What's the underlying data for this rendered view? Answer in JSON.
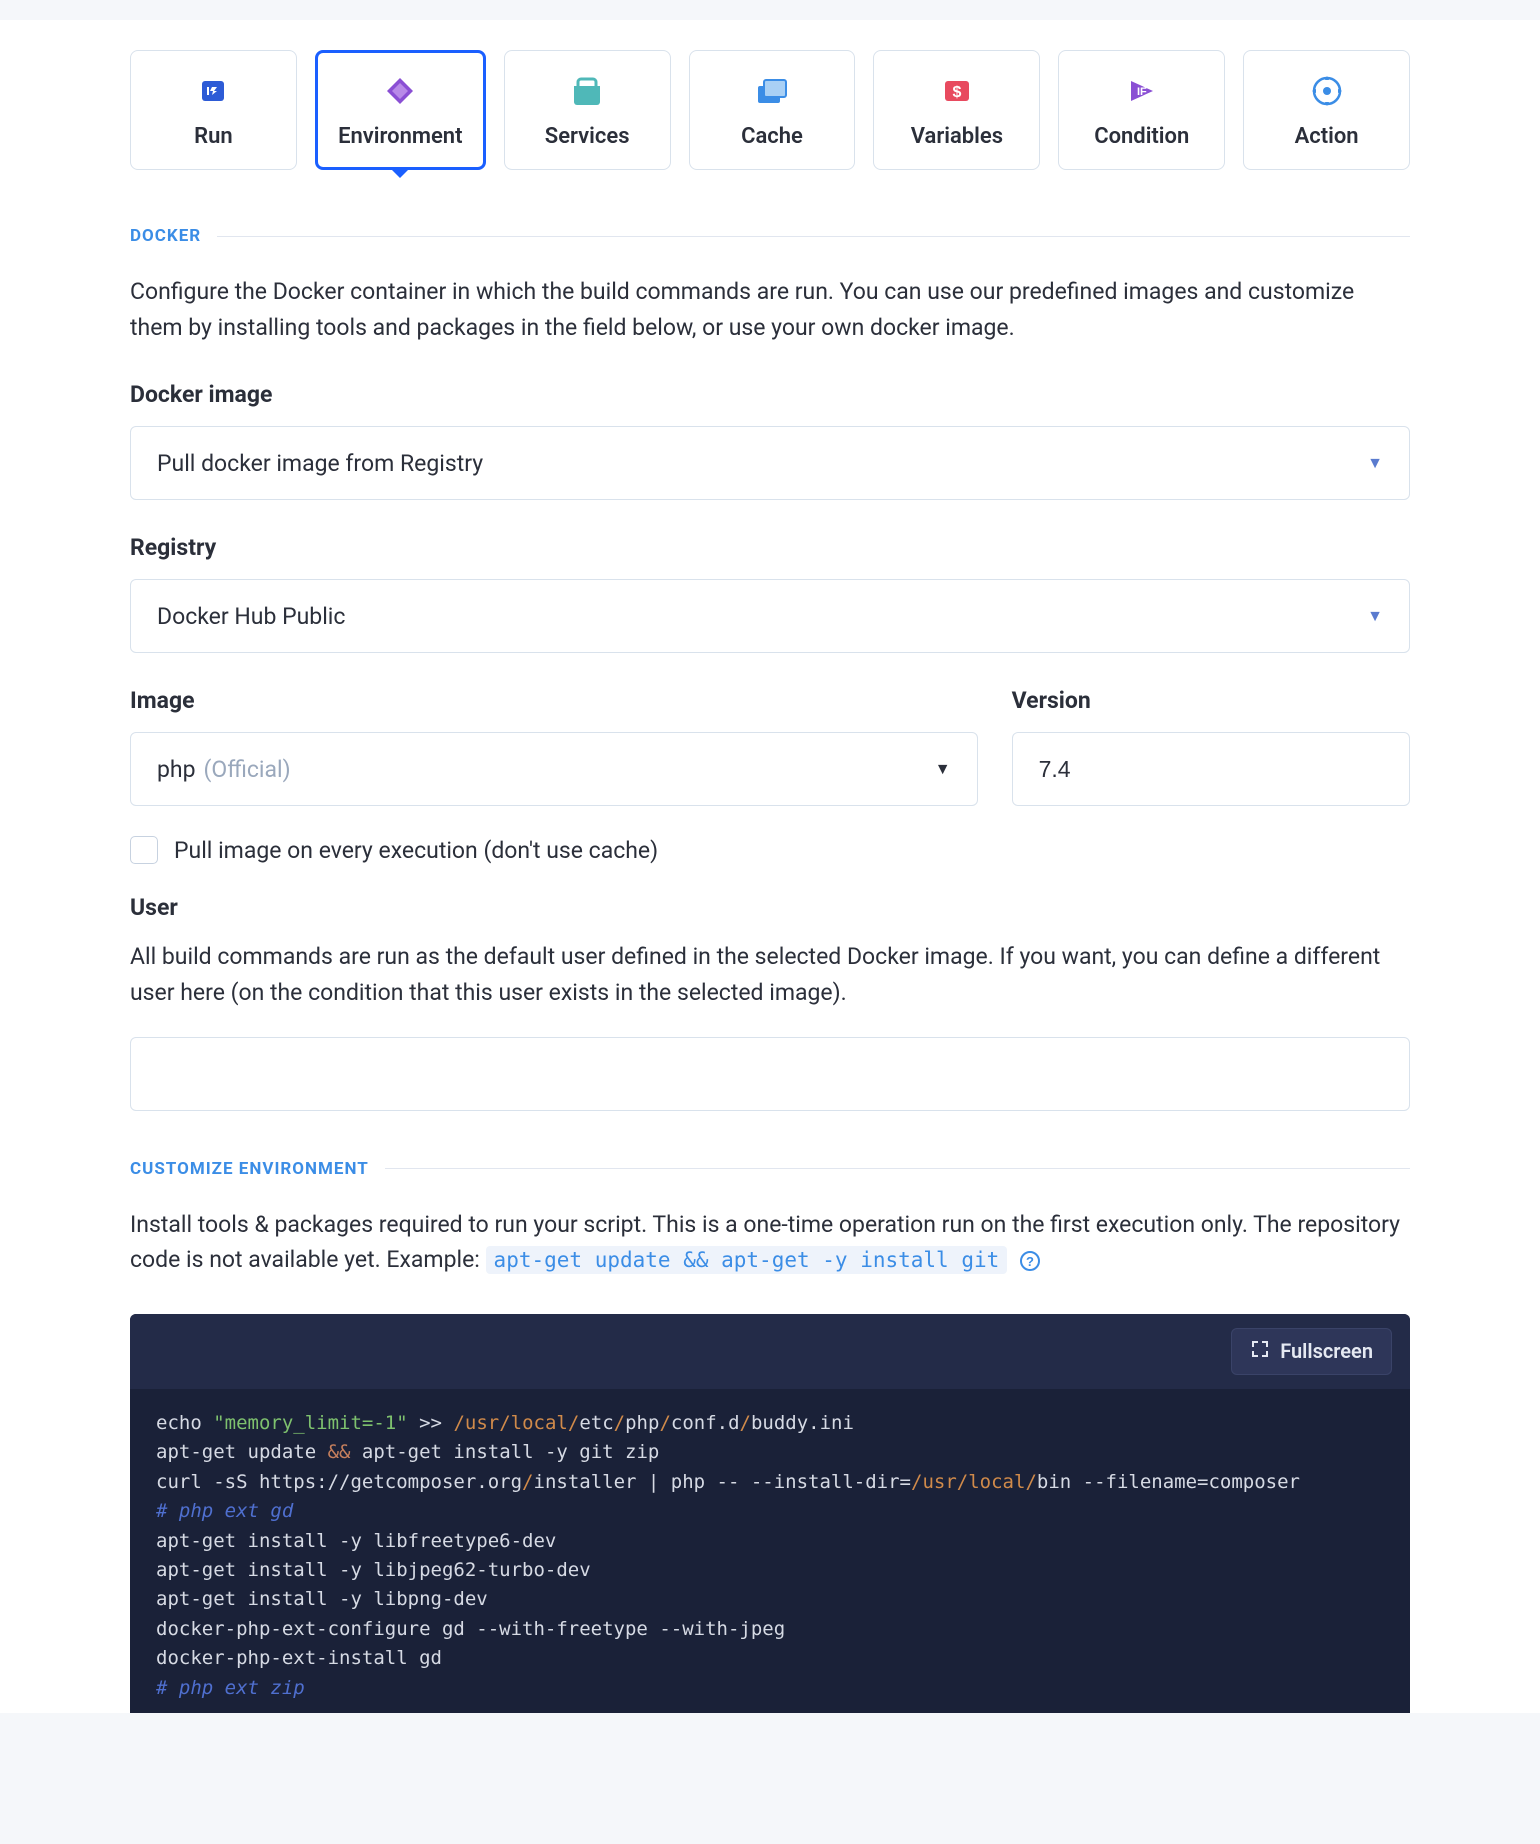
{
  "tabs": [
    {
      "id": "run",
      "label": "Run"
    },
    {
      "id": "environment",
      "label": "Environment"
    },
    {
      "id": "services",
      "label": "Services"
    },
    {
      "id": "cache",
      "label": "Cache"
    },
    {
      "id": "variables",
      "label": "Variables"
    },
    {
      "id": "condition",
      "label": "Condition"
    },
    {
      "id": "action",
      "label": "Action"
    }
  ],
  "active_tab": "environment",
  "docker": {
    "section_label": "DOCKER",
    "description": "Configure the Docker container in which the build commands are run. You can use our predefined images and customize them by installing tools and packages in the field below, or use your own docker image.",
    "image_label": "Docker image",
    "image_select": "Pull docker image from Registry",
    "registry_label": "Registry",
    "registry_select": "Docker Hub Public",
    "image_field_label": "Image",
    "image_value": "php",
    "image_official": "(Official)",
    "version_label": "Version",
    "version_value": "7.4",
    "pull_checkbox_label": "Pull image on every execution (don't use cache)",
    "pull_checked": false,
    "user_label": "User",
    "user_description": "All build commands are run as the default user defined in the selected Docker image. If you want, you can define a different user here (on the condition that this user exists in the selected image).",
    "user_value": ""
  },
  "customize": {
    "section_label": "CUSTOMIZE ENVIRONMENT",
    "description": "Install tools & packages required to run your script. This is a one-time operation run on the first execution only. The repository code is not available yet. Example: ",
    "example_code": "apt-get update && apt-get -y install git",
    "fullscreen_label": "Fullscreen",
    "code_lines": [
      "echo \"memory_limit=-1\" >> /usr/local/etc/php/conf.d/buddy.ini",
      "apt-get update && apt-get install -y git zip",
      "curl -sS https://getcomposer.org/installer | php -- --install-dir=/usr/local/bin --filename=composer",
      "# php ext gd",
      "apt-get install -y libfreetype6-dev",
      "apt-get install -y libjpeg62-turbo-dev",
      "apt-get install -y libpng-dev",
      "docker-php-ext-configure gd --with-freetype --with-jpeg",
      "docker-php-ext-install gd",
      "# php ext zip"
    ]
  },
  "colors": {
    "accent_blue": "#1a5fff",
    "link_blue": "#3b8de6",
    "border": "#d9e2ec",
    "editor_bg": "#1a2138"
  }
}
